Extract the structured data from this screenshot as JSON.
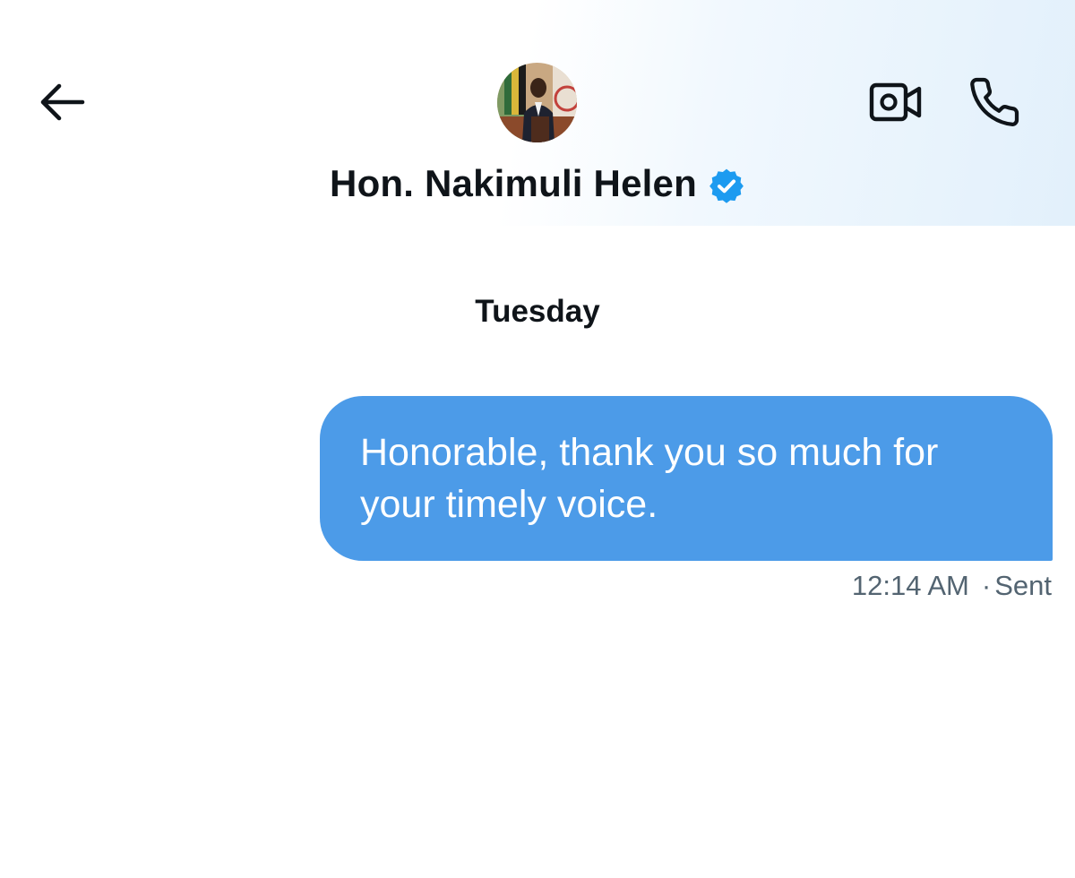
{
  "header": {
    "contact_name": "Hon. Nakimuli Helen",
    "verified": true
  },
  "icons": {
    "back": "back-arrow-icon",
    "video": "video-call-icon",
    "phone": "phone-call-icon",
    "verified": "verified-badge-icon"
  },
  "colors": {
    "bubble": "#4c9be8",
    "verified": "#1d9bf0",
    "text_primary": "#0f1419",
    "text_secondary": "#536471"
  },
  "conversation": {
    "day_separator": "Tuesday",
    "messages": [
      {
        "text": "Honorable, thank you so much for\nyour timely voice.",
        "time": "12:14 AM",
        "separator": "·",
        "status": "Sent",
        "direction": "outgoing"
      }
    ]
  }
}
